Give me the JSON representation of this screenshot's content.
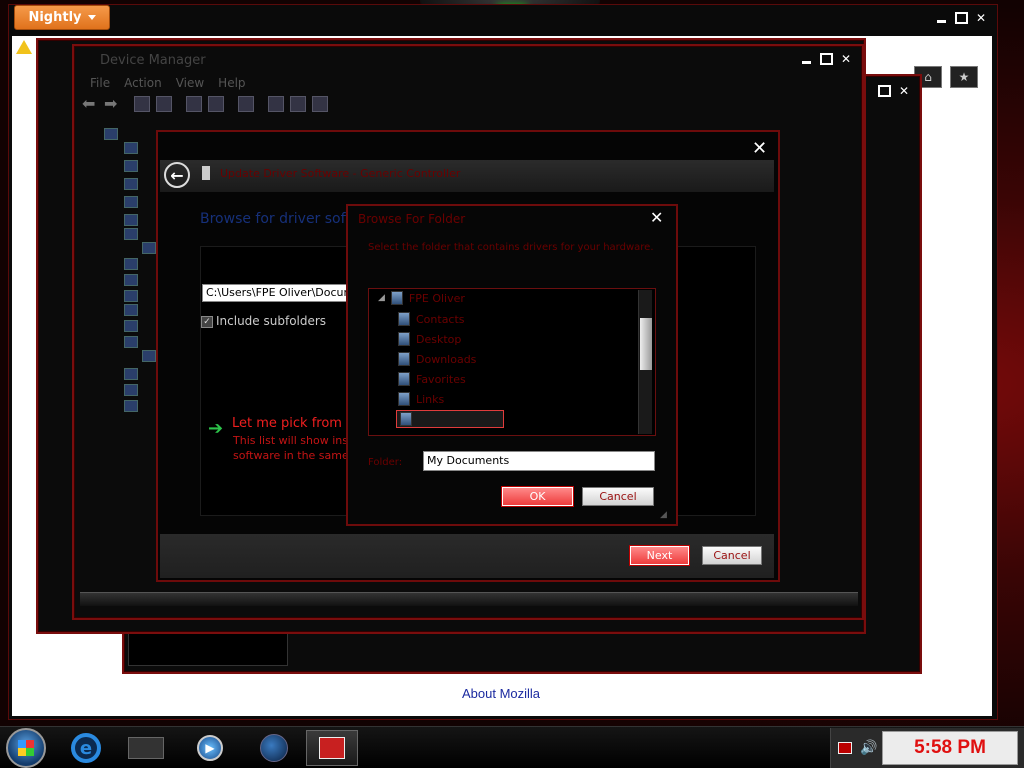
{
  "browser": {
    "menu_button": "Nightly",
    "footer_link": "About Mozilla"
  },
  "device_manager": {
    "title": "Device Manager",
    "menu": [
      "File",
      "Action",
      "View",
      "Help"
    ]
  },
  "wizard": {
    "title": "Update Driver Software - Generic Controller",
    "heading": "Browse for driver soft",
    "path_value": "C:\\Users\\FPE Oliver\\Docur",
    "include_subfolders_label": "Include subfolders",
    "pick_title": "Let me pick from",
    "pick_desc_1": "This list will show inst",
    "pick_desc_2": "software in the same",
    "next_label": "Next",
    "cancel_label": "Cancel"
  },
  "browse_dialog": {
    "title": "Browse For Folder",
    "instruction": "Select the folder that contains drivers for your hardware.",
    "tree_root": "FPE Oliver",
    "tree_items": [
      "Contacts",
      "Desktop",
      "Downloads",
      "Favorites",
      "Links"
    ],
    "folder_label": "Folder:",
    "folder_value": "My Documents",
    "ok_label": "OK",
    "cancel_label": "Cancel"
  },
  "taskbar": {
    "clock": "5:58 PM"
  },
  "colors": {
    "accent_red": "#ee3c3c",
    "frame_red": "#6d0b0b",
    "nightly_orange": "#e0721c"
  }
}
